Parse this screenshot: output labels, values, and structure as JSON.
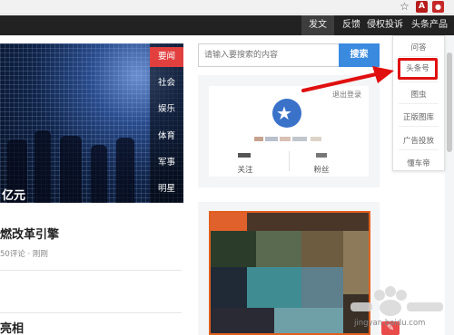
{
  "topnav": {
    "items": [
      "发文",
      "反馈",
      "侵权投诉",
      "头条产品"
    ]
  },
  "hero": {
    "caption": "亿元",
    "categories": [
      "要闻",
      "社会",
      "娱乐",
      "体育",
      "军事",
      "明星"
    ],
    "active_category": "要闻"
  },
  "articles": [
    {
      "title": "燃改革引擎",
      "meta": "50评论 · 刚刚",
      "close": "×"
    },
    {
      "title": "",
      "meta": "",
      "close": "×"
    },
    {
      "title": "亮相",
      "meta": "",
      "close": "×"
    }
  ],
  "search": {
    "placeholder": "请输入要搜索的内容",
    "button": "搜索"
  },
  "profile": {
    "logout": "退出登录",
    "follow_label": "关注",
    "fans_label": "粉丝"
  },
  "dropdown": {
    "items": [
      "问答",
      "头条号",
      "图虫",
      "正版图库",
      "广告投放",
      "懂车帝"
    ],
    "highlighted": "头条号"
  },
  "watermark": {
    "text": "jingyan.baidu.com"
  },
  "colors": {
    "accent_red": "#e1403f",
    "search_blue": "#3a8ae0",
    "highlight_red": "#e01010",
    "nav_dark": "#222222"
  }
}
